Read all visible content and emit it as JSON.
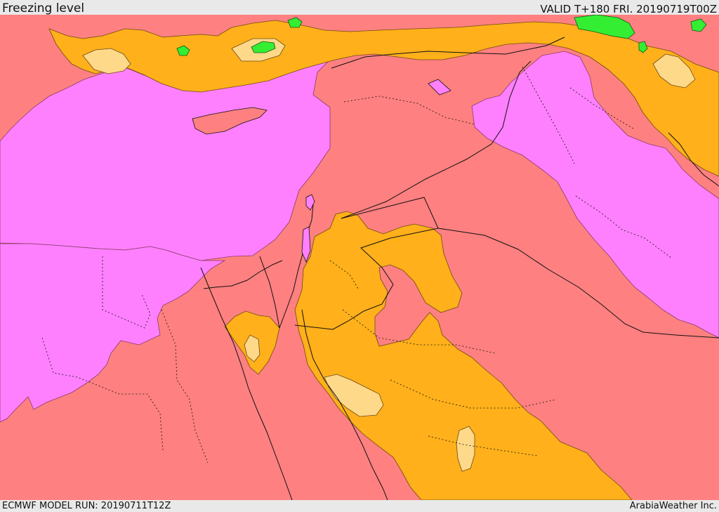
{
  "header": {
    "title": "Freezing level",
    "valid": "VALID T+180 FRI. 20190719T00Z"
  },
  "footer": {
    "model_run": "ECMWF MODEL RUN: 20190711T12Z",
    "credit": "ArabiaWeather Inc."
  },
  "colors": {
    "salmon": "#ff8080",
    "magenta": "#ff80ff",
    "orange": "#ffb01a",
    "pale_yellow": "#ffd98a",
    "green": "#33ee33",
    "border": "#111111",
    "frame": "#e9e9e9"
  }
}
